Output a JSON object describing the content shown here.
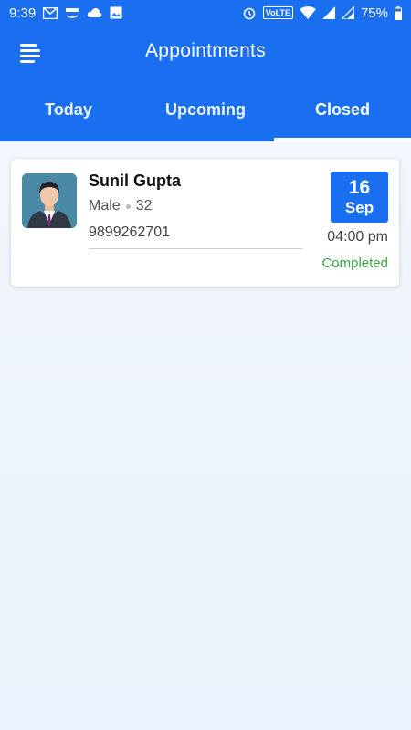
{
  "status_bar": {
    "time": "9:39",
    "network_badge": "VoLTE",
    "battery": "75%",
    "icons_left": [
      "gmail-icon",
      "amazon-icon",
      "cloud-icon",
      "image-icon"
    ],
    "icons_right": [
      "alarm-icon",
      "volte-icon",
      "wifi-icon",
      "signal-icon",
      "signal-icon",
      "battery-icon"
    ]
  },
  "header": {
    "title": "Appointments",
    "menu_icon": "menu-icon"
  },
  "tabs": [
    {
      "label": "Today",
      "active": false
    },
    {
      "label": "Upcoming",
      "active": false
    },
    {
      "label": "Closed",
      "active": true
    }
  ],
  "appointments": [
    {
      "name": "Sunil Gupta",
      "gender": "Male",
      "age": "32",
      "phone": "9899262701",
      "date_day": "16",
      "date_month": "Sep",
      "time": "04:00 pm",
      "status": "Completed"
    }
  ],
  "colors": {
    "primary": "#1a6ff0",
    "completed": "#3aa843"
  }
}
